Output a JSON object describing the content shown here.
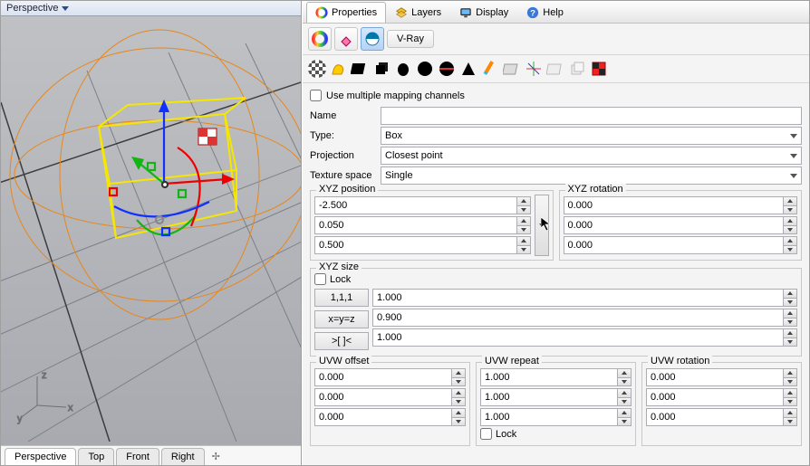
{
  "viewport": {
    "title": "Perspective"
  },
  "view_tabs": [
    "Perspective",
    "Top",
    "Front",
    "Right"
  ],
  "top_tabs": [
    {
      "label": "Properties",
      "active": true
    },
    {
      "label": "Layers",
      "active": false
    },
    {
      "label": "Display",
      "active": false
    },
    {
      "label": "Help",
      "active": false
    }
  ],
  "vray_label": "V-Ray",
  "use_multi_label": "Use multiple mapping channels",
  "labels": {
    "name": "Name",
    "type": "Type:",
    "projection": "Projection",
    "texture_space": "Texture space"
  },
  "values": {
    "name": "",
    "type": "Box",
    "projection": "Closest point",
    "texture_space": "Single"
  },
  "groups": {
    "xyz_position": "XYZ position",
    "xyz_rotation": "XYZ rotation",
    "xyz_size": "XYZ size",
    "uvw_offset": "UVW offset",
    "uvw_repeat": "UVW repeat",
    "uvw_rotation": "UVW rotation",
    "lock": "Lock"
  },
  "xyz_position": [
    "-2.500",
    "0.050",
    "0.500"
  ],
  "xyz_rotation": [
    "0.000",
    "0.000",
    "0.000"
  ],
  "xyz_size_buttons": [
    "1,1,1",
    "x=y=z",
    ">[ ]<"
  ],
  "xyz_size": [
    "1.000",
    "0.900",
    "1.000"
  ],
  "uvw_offset": [
    "0.000",
    "0.000",
    "0.000"
  ],
  "uvw_repeat": [
    "1.000",
    "1.000",
    "1.000"
  ],
  "uvw_rotation": [
    "0.000",
    "0.000",
    "0.000"
  ]
}
